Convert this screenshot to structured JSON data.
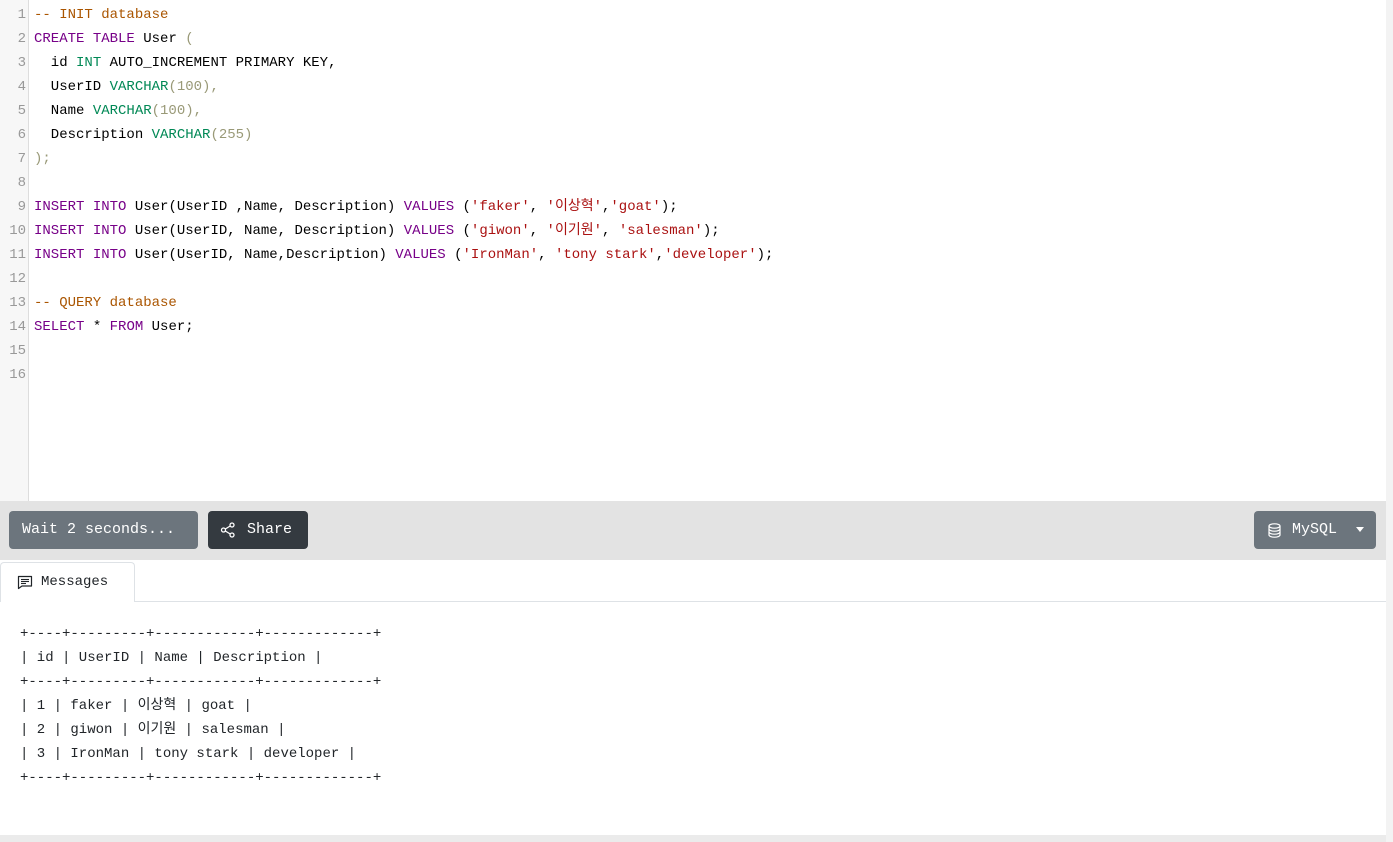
{
  "editor": {
    "line_numbers": [
      "1",
      "2",
      "3",
      "4",
      "5",
      "6",
      "7",
      "8",
      "9",
      "10",
      "11",
      "12",
      "13",
      "14",
      "15",
      "16"
    ],
    "lines": [
      [
        {
          "t": "-- INIT database",
          "c": "cm"
        }
      ],
      [
        {
          "t": "CREATE",
          "c": "kw"
        },
        {
          "t": " "
        },
        {
          "t": "TABLE",
          "c": "kw"
        },
        {
          "t": " User "
        },
        {
          "t": "(",
          "c": "pn"
        }
      ],
      [
        {
          "t": "  id "
        },
        {
          "t": "INT",
          "c": "ty"
        },
        {
          "t": " AUTO_INCREMENT PRIMARY KEY,"
        }
      ],
      [
        {
          "t": "  UserID "
        },
        {
          "t": "VARCHAR",
          "c": "ty"
        },
        {
          "t": "(100),",
          "c": "pn"
        }
      ],
      [
        {
          "t": "  Name "
        },
        {
          "t": "VARCHAR",
          "c": "ty"
        },
        {
          "t": "(100),",
          "c": "pn"
        }
      ],
      [
        {
          "t": "  Description "
        },
        {
          "t": "VARCHAR",
          "c": "ty"
        },
        {
          "t": "(255)",
          "c": "pn"
        }
      ],
      [
        {
          "t": ");",
          "c": "pn"
        }
      ],
      [],
      [
        {
          "t": "INSERT",
          "c": "kw"
        },
        {
          "t": " "
        },
        {
          "t": "INTO",
          "c": "kw"
        },
        {
          "t": " User(UserID ,Name, Description) "
        },
        {
          "t": "VALUES",
          "c": "kw"
        },
        {
          "t": " ("
        },
        {
          "t": "'faker'",
          "c": "st"
        },
        {
          "t": ", "
        },
        {
          "t": "'이상혁'",
          "c": "st"
        },
        {
          "t": ","
        },
        {
          "t": "'goat'",
          "c": "st"
        },
        {
          "t": ");"
        }
      ],
      [
        {
          "t": "INSERT",
          "c": "kw"
        },
        {
          "t": " "
        },
        {
          "t": "INTO",
          "c": "kw"
        },
        {
          "t": " User(UserID, Name, Description) "
        },
        {
          "t": "VALUES",
          "c": "kw"
        },
        {
          "t": " ("
        },
        {
          "t": "'giwon'",
          "c": "st"
        },
        {
          "t": ", "
        },
        {
          "t": "'이기원'",
          "c": "st"
        },
        {
          "t": ", "
        },
        {
          "t": "'salesman'",
          "c": "st"
        },
        {
          "t": ");"
        }
      ],
      [
        {
          "t": "INSERT",
          "c": "kw"
        },
        {
          "t": " "
        },
        {
          "t": "INTO",
          "c": "kw"
        },
        {
          "t": " User(UserID, Name,Description) "
        },
        {
          "t": "VALUES",
          "c": "kw"
        },
        {
          "t": " ("
        },
        {
          "t": "'IronMan'",
          "c": "st"
        },
        {
          "t": ", "
        },
        {
          "t": "'tony stark'",
          "c": "st"
        },
        {
          "t": ","
        },
        {
          "t": "'developer'",
          "c": "st"
        },
        {
          "t": ");"
        }
      ],
      [],
      [
        {
          "t": "-- QUERY database",
          "c": "cm"
        }
      ],
      [
        {
          "t": "SELECT",
          "c": "kw"
        },
        {
          "t": " * "
        },
        {
          "t": "FROM",
          "c": "kw"
        },
        {
          "t": " User;"
        }
      ],
      [],
      []
    ]
  },
  "toolbar": {
    "run_label": "Wait 2 seconds...",
    "share_label": "Share",
    "db_label": "MySQL",
    "share_icon": "share-icon",
    "db_icon": "database-icon"
  },
  "results": {
    "tab_label": "Messages",
    "tab_icon": "message-icon",
    "output": [
      "+----+---------+------------+-------------+",
      "| id | UserID | Name | Description |",
      "+----+---------+------------+-------------+",
      "| 1 | faker | 이상혁 | goat |",
      "| 2 | giwon | 이기원 | salesman |",
      "| 3 | IronMan | tony stark | developer |",
      "+----+---------+------------+-------------+"
    ]
  },
  "colors": {
    "keyword": "#770088",
    "type": "#008855",
    "string": "#aa1111",
    "comment": "#aa5500",
    "dark_button": "#343a40",
    "secondary_button": "#6c757d"
  }
}
